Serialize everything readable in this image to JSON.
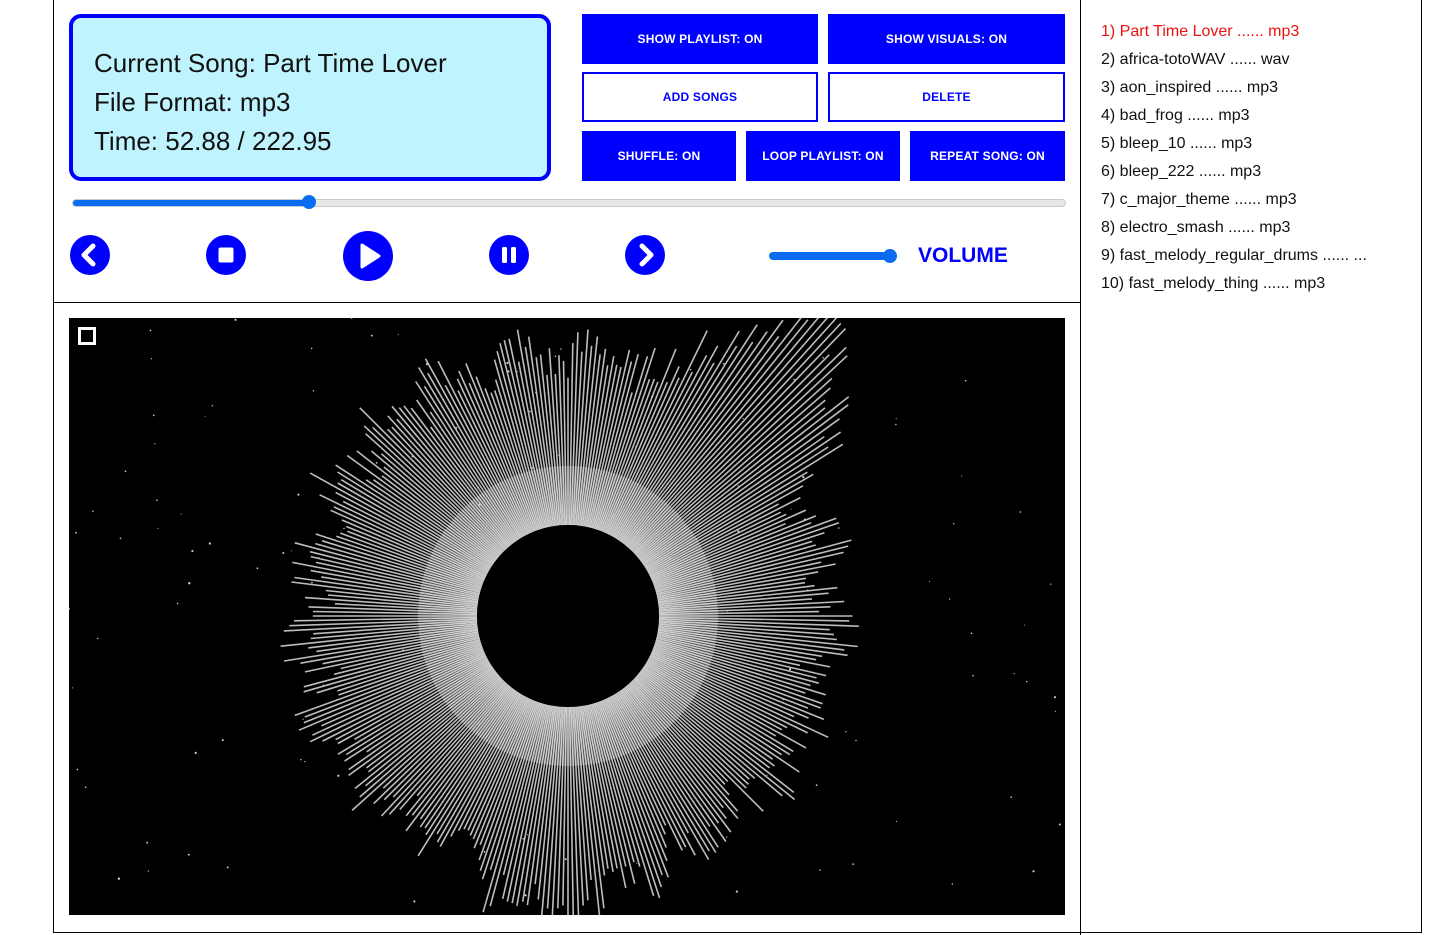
{
  "now_playing": {
    "song_line": "Current Song: Part Time Lover",
    "format_line": "File Format: mp3",
    "time_line": "Time: 52.88 / 222.95"
  },
  "buttons": {
    "show_playlist": "SHOW PLAYLIST: ON",
    "show_visuals": "SHOW VISUALS: ON",
    "add_songs": "ADD SONGS",
    "delete": "DELETE",
    "shuffle": "SHUFFLE: ON",
    "loop_playlist": "LOOP PLAYLIST: ON",
    "repeat_song": "REPEAT SONG: ON"
  },
  "progress": {
    "current": 52.88,
    "total": 222.95
  },
  "volume": {
    "label": "VOLUME",
    "level": 1.0
  },
  "playlist": [
    {
      "text": "1) Part Time Lover ...... mp3",
      "active": true
    },
    {
      "text": "2) africa-totoWAV ...... wav",
      "active": false
    },
    {
      "text": "3) aon_inspired ...... mp3",
      "active": false
    },
    {
      "text": "4) bad_frog ...... mp3",
      "active": false
    },
    {
      "text": "5) bleep_10 ...... mp3",
      "active": false
    },
    {
      "text": "6) bleep_222 ...... mp3",
      "active": false
    },
    {
      "text": "7) c_major_theme ...... mp3",
      "active": false
    },
    {
      "text": "8) electro_smash ...... mp3",
      "active": false
    },
    {
      "text": "9) fast_melody_regular_drums ...... ...",
      "active": false
    },
    {
      "text": "10) fast_melody_thing ...... mp3",
      "active": false
    }
  ],
  "colors": {
    "accent": "#0000ff",
    "info_bg": "#bff3fd",
    "slider": "#0a6cf0",
    "active_track": "#ee1111",
    "visual_bg": "#000000"
  },
  "icons": [
    "previous-icon",
    "stop-icon",
    "play-icon",
    "pause-icon",
    "next-icon"
  ]
}
